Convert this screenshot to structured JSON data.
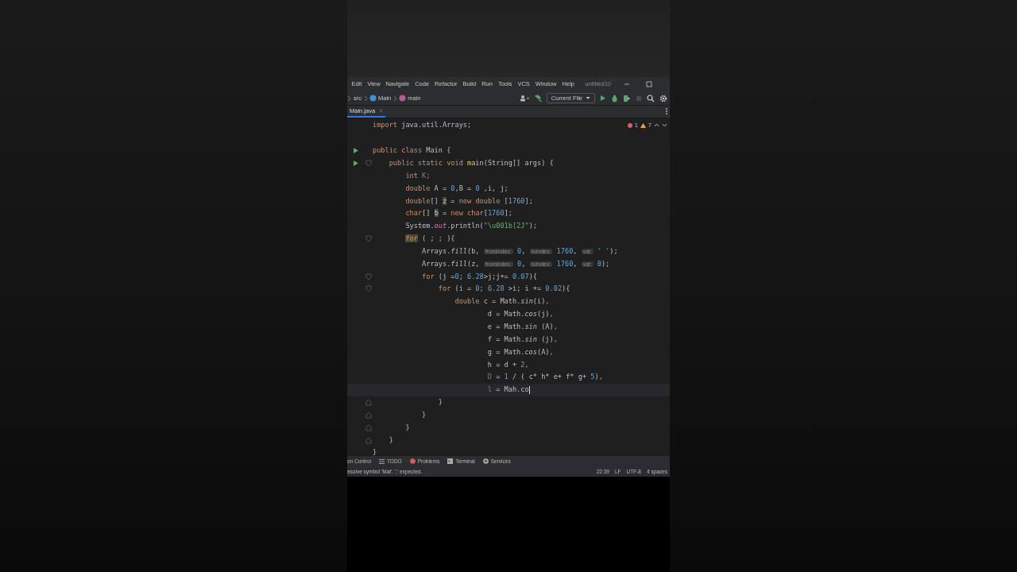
{
  "menu": [
    "Edit",
    "View",
    "Navigate",
    "Code",
    "Refactor",
    "Build",
    "Run",
    "Tools",
    "VCS",
    "Window",
    "Help"
  ],
  "project": "untitled10",
  "breadcrumbs": [
    {
      "kind": "folder",
      "label": "src"
    },
    {
      "kind": "class",
      "label": "Main"
    },
    {
      "kind": "method",
      "label": "main"
    }
  ],
  "run_config": "Current File",
  "tabs": [
    {
      "label": "Main.java",
      "selected": true
    }
  ],
  "inspections": {
    "errors": "1",
    "warnings": "7"
  },
  "lines": [
    {
      "current": false,
      "run": false,
      "fold_start": false,
      "fold_end": false,
      "segments": [
        {
          "kind": "kw",
          "text": "import"
        },
        {
          "kind": "plain",
          "text": " java.util.Arrays;"
        }
      ]
    },
    {
      "current": false,
      "run": false,
      "fold_start": false,
      "fold_end": false
    },
    {
      "current": false,
      "run": true,
      "fold_start": false,
      "fold_end": false,
      "segments": [
        {
          "kind": "kw",
          "text": "public class"
        },
        {
          "kind": "plain",
          "text": " Main {"
        }
      ]
    },
    {
      "current": false,
      "run": true,
      "fold_start": true,
      "fold_end": false,
      "segments": [
        {
          "kind": "kw",
          "text": "    public static void "
        },
        {
          "kind": "decl",
          "text": "main"
        },
        {
          "kind": "plain",
          "text": "(String[] args) {"
        }
      ]
    },
    {
      "current": false,
      "run": false,
      "fold_start": false,
      "fold_end": false,
      "segments": [
        {
          "kind": "kw",
          "text": "        int"
        },
        {
          "kind": "unused",
          "text": " K"
        },
        {
          "kind": "kw",
          "text": ";"
        }
      ]
    },
    {
      "current": false,
      "run": false,
      "fold_start": false,
      "fold_end": false,
      "segments": [
        {
          "kind": "kw",
          "text": "        double"
        },
        {
          "kind": "plain",
          "text": " A = "
        },
        {
          "kind": "num",
          "text": "0"
        },
        {
          "kind": "plain",
          "text": ",B = "
        },
        {
          "kind": "num",
          "text": "0"
        },
        {
          "kind": "plain",
          "text": " ,i, j;"
        }
      ]
    },
    {
      "current": false,
      "run": false,
      "fold_start": false,
      "fold_end": false,
      "segments": [
        {
          "kind": "kw",
          "text": "        double"
        },
        {
          "kind": "plain",
          "text": "[] "
        },
        {
          "kind": "mark",
          "text": "z"
        },
        {
          "kind": "plain",
          "text": " = "
        },
        {
          "kind": "kw",
          "text": "new double"
        },
        {
          "kind": "plain",
          "text": " ["
        },
        {
          "kind": "num",
          "text": "1760"
        },
        {
          "kind": "plain",
          "text": "];"
        }
      ]
    },
    {
      "current": false,
      "run": false,
      "fold_start": false,
      "fold_end": false,
      "segments": [
        {
          "kind": "kw",
          "text": "        char"
        },
        {
          "kind": "plain",
          "text": "[] "
        },
        {
          "kind": "mark",
          "text": "b"
        },
        {
          "kind": "plain",
          "text": " = "
        },
        {
          "kind": "kw",
          "text": "new char"
        },
        {
          "kind": "plain",
          "text": "["
        },
        {
          "kind": "num",
          "text": "1760"
        },
        {
          "kind": "plain",
          "text": "];"
        }
      ]
    },
    {
      "current": false,
      "run": false,
      "fold_start": false,
      "fold_end": false,
      "segments": [
        {
          "kind": "plain",
          "text": "        System."
        },
        {
          "kind": "field",
          "text": "out"
        },
        {
          "kind": "plain",
          "text": ".println("
        },
        {
          "kind": "str",
          "text": "\"\\u001b[2J\""
        },
        {
          "kind": "plain",
          "text": ");"
        }
      ]
    },
    {
      "current": false,
      "run": false,
      "fold_start": true,
      "fold_end": false,
      "segments": [
        {
          "kind": "markkw",
          "text": "        for"
        },
        {
          "kind": "plain",
          "text": " ( ; ; ){"
        }
      ]
    },
    {
      "current": false,
      "run": false,
      "fold_start": false,
      "fold_end": false,
      "segments": [
        {
          "kind": "plain",
          "text": "            Arrays."
        },
        {
          "kind": "ital",
          "text": "fill"
        },
        {
          "kind": "plain",
          "text": "(b, "
        },
        {
          "kind": "hint",
          "text": "fromIndex:"
        },
        {
          "kind": "num",
          "text": " 0"
        },
        {
          "kind": "plain",
          "text": ", "
        },
        {
          "kind": "hint",
          "text": "toIndex:"
        },
        {
          "kind": "num",
          "text": " 1760"
        },
        {
          "kind": "plain",
          "text": ", "
        },
        {
          "kind": "hint",
          "text": "val:"
        },
        {
          "kind": "str",
          "text": " ' '"
        },
        {
          "kind": "plain",
          "text": ");"
        }
      ]
    },
    {
      "current": false,
      "run": false,
      "fold_start": false,
      "fold_end": false,
      "segments": [
        {
          "kind": "plain",
          "text": "            Arrays."
        },
        {
          "kind": "ital",
          "text": "fill"
        },
        {
          "kind": "plain",
          "text": "(z, "
        },
        {
          "kind": "hint",
          "text": "fromIndex:"
        },
        {
          "kind": "num",
          "text": " 0"
        },
        {
          "kind": "plain",
          "text": ", "
        },
        {
          "kind": "hint",
          "text": "toIndex:"
        },
        {
          "kind": "num",
          "text": " 1760"
        },
        {
          "kind": "plain",
          "text": ", "
        },
        {
          "kind": "hint",
          "text": "val:"
        },
        {
          "kind": "num",
          "text": " 0"
        },
        {
          "kind": "plain",
          "text": ");"
        }
      ]
    },
    {
      "current": false,
      "run": false,
      "fold_start": true,
      "fold_end": false,
      "segments": [
        {
          "kind": "kw",
          "text": "            for"
        },
        {
          "kind": "plain",
          "text": " (j ="
        },
        {
          "kind": "num",
          "text": "0"
        },
        {
          "kind": "plain",
          "text": "; "
        },
        {
          "kind": "num",
          "text": "6.28"
        },
        {
          "kind": "plain",
          "text": ">j;j+= "
        },
        {
          "kind": "num",
          "text": "0.07"
        },
        {
          "kind": "plain",
          "text": "){"
        }
      ]
    },
    {
      "current": false,
      "run": false,
      "fold_start": true,
      "fold_end": false,
      "segments": [
        {
          "kind": "kw",
          "text": "                for"
        },
        {
          "kind": "plain",
          "text": " (i = "
        },
        {
          "kind": "num",
          "text": "0"
        },
        {
          "kind": "plain",
          "text": "; "
        },
        {
          "kind": "num",
          "text": "6.28"
        },
        {
          "kind": "plain",
          "text": " >i; i += "
        },
        {
          "kind": "num",
          "text": "0.02"
        },
        {
          "kind": "plain",
          "text": "){"
        }
      ]
    },
    {
      "current": false,
      "run": false,
      "fold_start": false,
      "fold_end": false,
      "segments": [
        {
          "kind": "kw",
          "text": "                    double"
        },
        {
          "kind": "plain",
          "text": " c = Math."
        },
        {
          "kind": "ital",
          "text": "sin"
        },
        {
          "kind": "plain",
          "text": "(i)"
        },
        {
          "kind": "kw",
          "text": ","
        }
      ]
    },
    {
      "current": false,
      "run": false,
      "fold_start": false,
      "fold_end": false,
      "segments": [
        {
          "kind": "plain",
          "text": "                            d = Math."
        },
        {
          "kind": "ital",
          "text": "cos"
        },
        {
          "kind": "plain",
          "text": "(j)"
        },
        {
          "kind": "kw",
          "text": ","
        }
      ]
    },
    {
      "current": false,
      "run": false,
      "fold_start": false,
      "fold_end": false,
      "segments": [
        {
          "kind": "plain",
          "text": "                            e = Math."
        },
        {
          "kind": "ital",
          "text": "sin"
        },
        {
          "kind": "plain",
          "text": " (A)"
        },
        {
          "kind": "kw",
          "text": ","
        }
      ]
    },
    {
      "current": false,
      "run": false,
      "fold_start": false,
      "fold_end": false,
      "segments": [
        {
          "kind": "plain",
          "text": "                            f = Math."
        },
        {
          "kind": "ital",
          "text": "sin"
        },
        {
          "kind": "plain",
          "text": " (j)"
        },
        {
          "kind": "kw",
          "text": ","
        }
      ]
    },
    {
      "current": false,
      "run": false,
      "fold_start": false,
      "fold_end": false,
      "segments": [
        {
          "kind": "plain",
          "text": "                            g = Math."
        },
        {
          "kind": "ital",
          "text": "cos"
        },
        {
          "kind": "plain",
          "text": "(A)"
        },
        {
          "kind": "kw",
          "text": ","
        }
      ]
    },
    {
      "current": false,
      "run": false,
      "fold_start": false,
      "fold_end": false,
      "segments": [
        {
          "kind": "plain",
          "text": "                            h = d + "
        },
        {
          "kind": "num",
          "text": "2"
        },
        {
          "kind": "kw",
          "text": ","
        }
      ]
    },
    {
      "current": false,
      "run": false,
      "fold_start": false,
      "fold_end": false,
      "segments": [
        {
          "kind": "unused",
          "text": "                            D"
        },
        {
          "kind": "plain",
          "text": " = "
        },
        {
          "kind": "num",
          "text": "1"
        },
        {
          "kind": "plain",
          "text": " / ( c* h* e+ f* g+ "
        },
        {
          "kind": "num",
          "text": "5"
        },
        {
          "kind": "plain",
          "text": ")"
        },
        {
          "kind": "kw",
          "text": ","
        }
      ]
    },
    {
      "current": true,
      "run": false,
      "fold_start": false,
      "fold_end": false,
      "segments": [
        {
          "kind": "unused",
          "text": "                            l"
        },
        {
          "kind": "plain",
          "text": " = Mah.co"
        }
      ]
    },
    {
      "current": false,
      "run": false,
      "fold_start": false,
      "fold_end": true,
      "segments": [
        {
          "kind": "plain",
          "text": "                }"
        }
      ]
    },
    {
      "current": false,
      "run": false,
      "fold_start": false,
      "fold_end": true,
      "segments": [
        {
          "kind": "plain",
          "text": "            }"
        }
      ]
    },
    {
      "current": false,
      "run": false,
      "fold_start": false,
      "fold_end": true,
      "segments": [
        {
          "kind": "plain",
          "text": "        }"
        }
      ]
    },
    {
      "current": false,
      "run": false,
      "fold_start": false,
      "fold_end": true,
      "segments": [
        {
          "kind": "plain",
          "text": "    }"
        }
      ]
    },
    {
      "current": false,
      "run": false,
      "fold_start": false,
      "fold_end": false,
      "segments": [
        {
          "kind": "plain",
          "text": "}"
        }
      ]
    }
  ],
  "tool_windows": [
    {
      "kind": "vcs",
      "label": "on Control"
    },
    {
      "kind": "todo",
      "label": "TODO"
    },
    {
      "kind": "problems",
      "label": "Problems"
    },
    {
      "kind": "terminal",
      "label": "Terminal"
    },
    {
      "kind": "services",
      "label": "Services"
    }
  ],
  "status_bar": {
    "message": "esolve symbol 'Mat'. ';' expected.",
    "items": [
      "22:39",
      "LF",
      "UTF-8",
      "4 spaces"
    ]
  }
}
